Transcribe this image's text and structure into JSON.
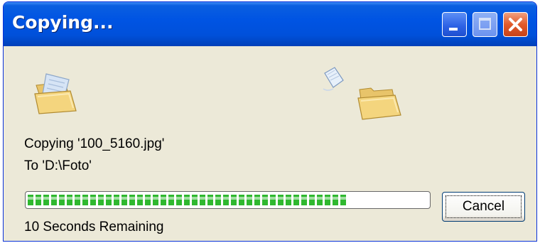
{
  "window": {
    "title": "Copying..."
  },
  "titlebar_buttons": {
    "minimize_icon": "minimize-icon",
    "maximize_icon": "maximize-icon",
    "close_icon": "close-icon"
  },
  "icons": {
    "source": "source-folder-icon",
    "flying": "flying-document-icon",
    "destination": "destination-folder-icon"
  },
  "status": {
    "copying_line": "Copying '100_5160.jpg'",
    "to_line": "To 'D:\\Foto'",
    "time_remaining": "10 Seconds Remaining"
  },
  "progress": {
    "value": 0.8
  },
  "buttons": {
    "cancel_label": "Cancel"
  },
  "colors": {
    "titlebar": "#0054E3",
    "dialog_background": "#ECE9D8",
    "progress_fill": "#2FB82F",
    "close_button": "#E05A2A"
  }
}
